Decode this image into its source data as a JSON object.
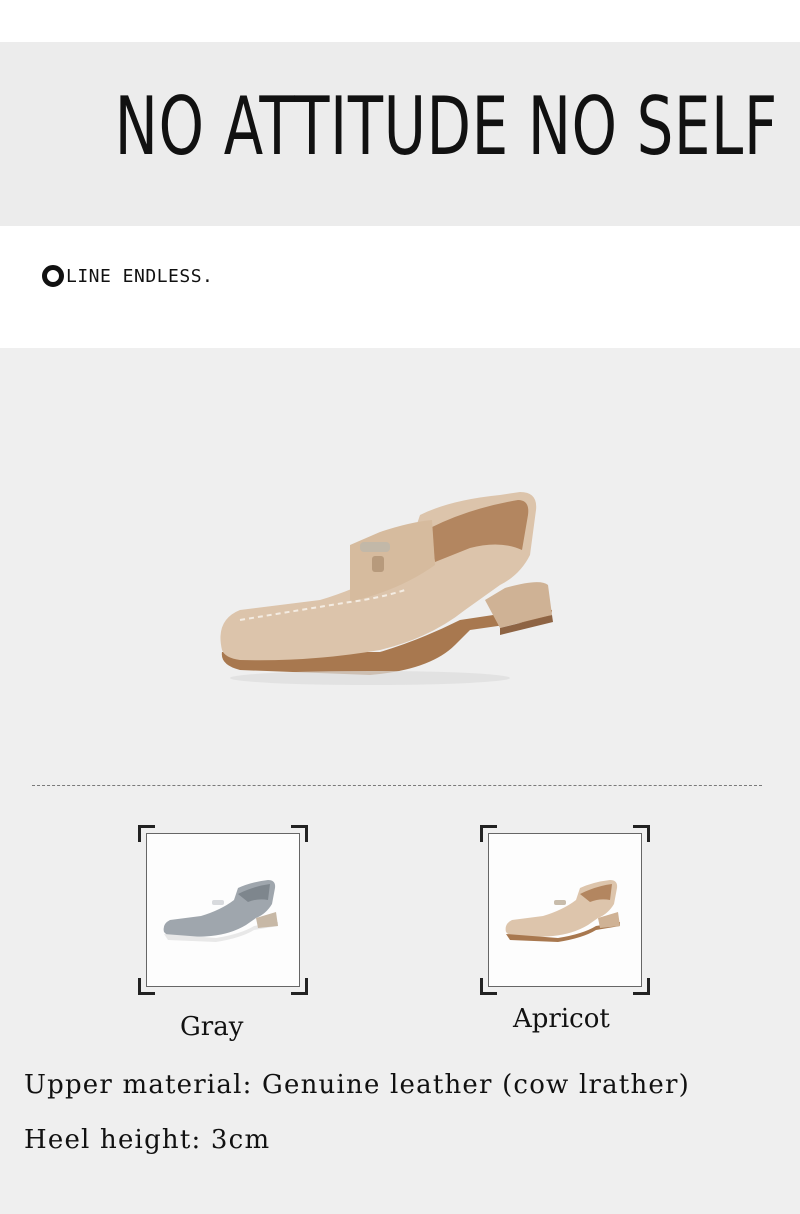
{
  "banner": {
    "slogan": "NO ATTITUDE  NO SELF"
  },
  "tagline": {
    "text": "LINE ENDLESS."
  },
  "variants": [
    {
      "label": "Gray",
      "color": "#9fa6ad"
    },
    {
      "label": "Apricot",
      "color": "#ddc5ac"
    }
  ],
  "hero": {
    "color": "#dcc4ab"
  },
  "specs": {
    "material": "Upper material: Genuine leather (cow lrather)",
    "heel": "Heel height: 3cm"
  }
}
